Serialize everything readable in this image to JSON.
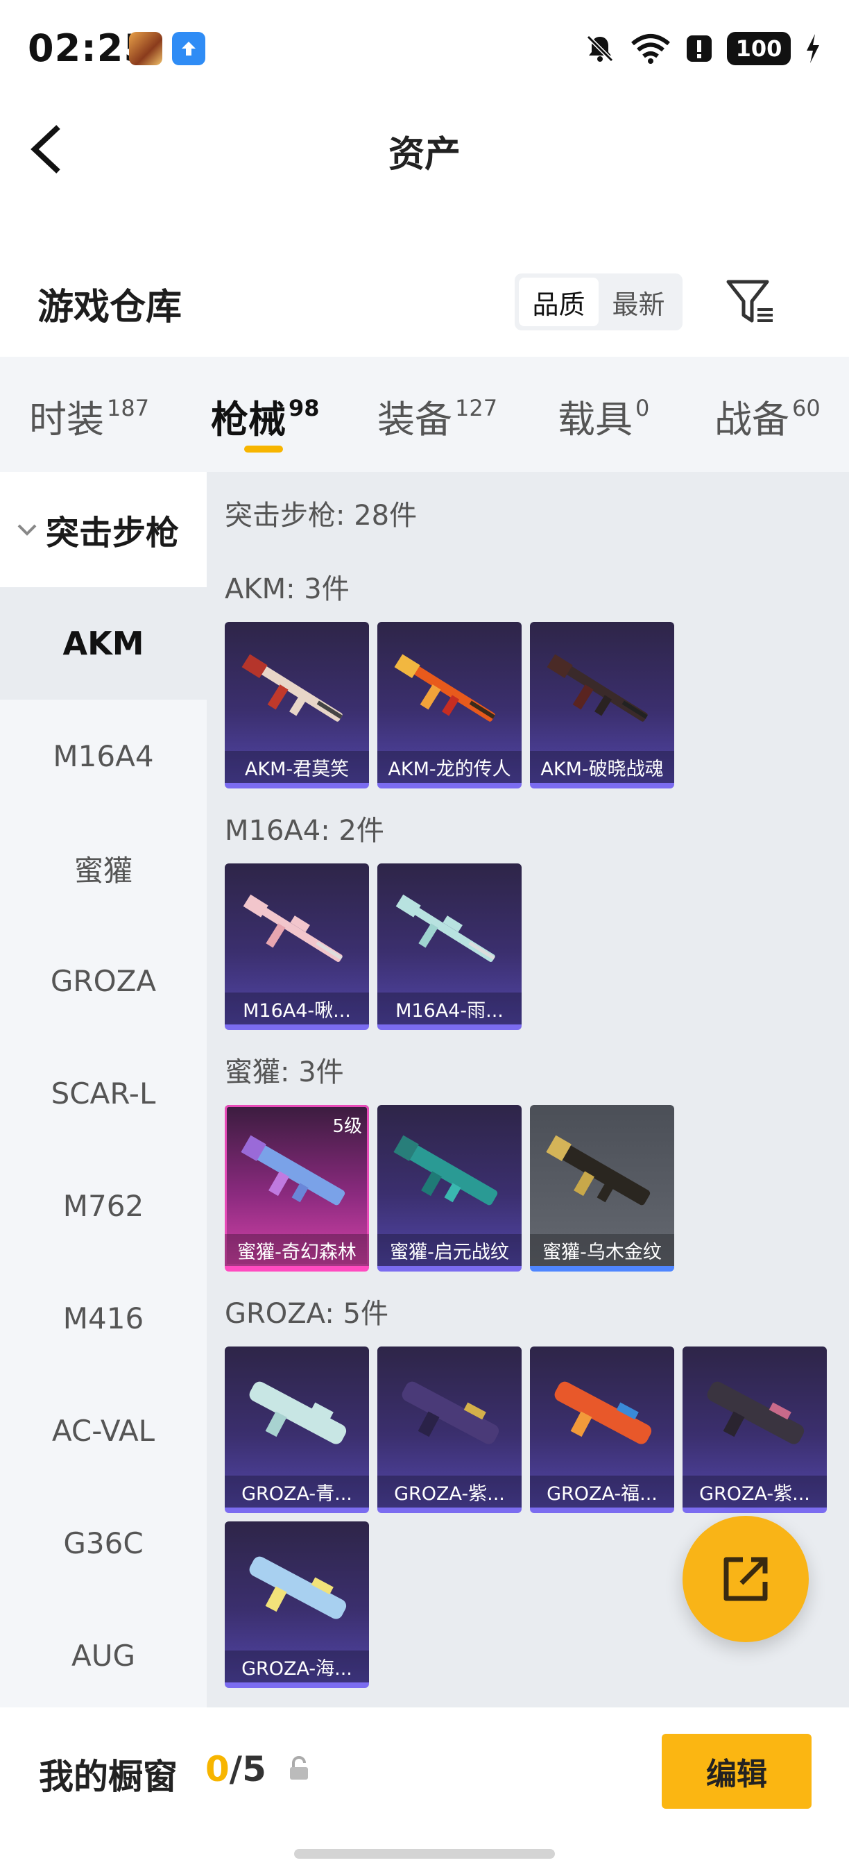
{
  "status_bar": {
    "time": "02:25",
    "battery": "100"
  },
  "header": {
    "title": "资产"
  },
  "section": {
    "title": "游戏仓库",
    "sort_options": [
      "品质",
      "最新"
    ]
  },
  "tabs": [
    {
      "label": "时装",
      "count": "187"
    },
    {
      "label": "枪械",
      "count": "98"
    },
    {
      "label": "装备",
      "count": "127"
    },
    {
      "label": "载具",
      "count": "0"
    },
    {
      "label": "战备",
      "count": "60"
    }
  ],
  "sidebar": {
    "group": "突击步枪",
    "items": [
      "AKM",
      "M16A4",
      "蜜獾",
      "GROZA",
      "SCAR-L",
      "M762",
      "M416",
      "AC-VAL",
      "G36C",
      "AUG"
    ]
  },
  "content": {
    "summary": "突击步枪: 28件",
    "groups": [
      {
        "label": "AKM: 3件",
        "items": [
          "AKM-君莫笑",
          "AKM-龙的传人",
          "AKM-破晓战魂"
        ]
      },
      {
        "label": "M16A4: 2件",
        "items": [
          "M16A4-啾...",
          "M16A4-雨..."
        ]
      },
      {
        "label": "蜜獾: 3件",
        "items": [
          "蜜獾-奇幻森林",
          "蜜獾-启元战纹",
          "蜜獾-乌木金纹"
        ],
        "badge": "5级"
      },
      {
        "label": "GROZA: 5件",
        "items": [
          "GROZA-青...",
          "GROZA-紫...",
          "GROZA-福...",
          "GROZA-紫...",
          "GROZA-海..."
        ]
      }
    ]
  },
  "bottom": {
    "title": "我的橱窗",
    "count_used": "0",
    "count_sep": "/",
    "count_total": "5",
    "edit_label": "编辑"
  },
  "colors": {
    "accent": "#f7b500",
    "card_purple": "#5246a8",
    "card_pink": "#d443a8",
    "card_gray": "#5a5e66"
  },
  "icons": [
    "back-arrow-icon",
    "filter-icon",
    "chevron-down-icon",
    "share-out-icon",
    "lock-icon",
    "mute-bell-icon",
    "wifi-icon",
    "alert-icon",
    "charging-icon"
  ]
}
